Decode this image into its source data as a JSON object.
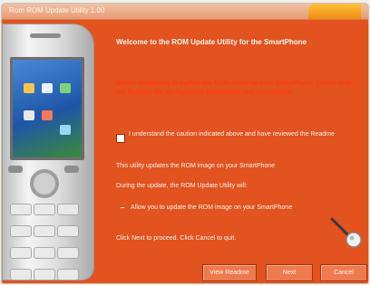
{
  "window": {
    "title": "Rom ROM Update Utility 1.00"
  },
  "main": {
    "heading": "Welcome to the ROM Update Utility for the SmartPhone",
    "warning": "Before continuing to update the ROM image on your SmartPhone, please read the Readme file for important information and instructions.",
    "checkbox_label": "I understand the caution indicated above and have reviewed the Readme",
    "line1": "This utility updates the ROM image on your SmartPhone",
    "line2": "During the update, the ROM Update Utility will:",
    "bullet1": "Allow you to update the ROM image on your SmartPhone",
    "line3": "Click Next to proceed. Click Cancel to quit."
  },
  "buttons": {
    "view_readme": "View Readme",
    "next": "Next",
    "cancel": "Cancel"
  },
  "colors": {
    "background": "#e2531f",
    "warning_text": "#ff3a14"
  }
}
